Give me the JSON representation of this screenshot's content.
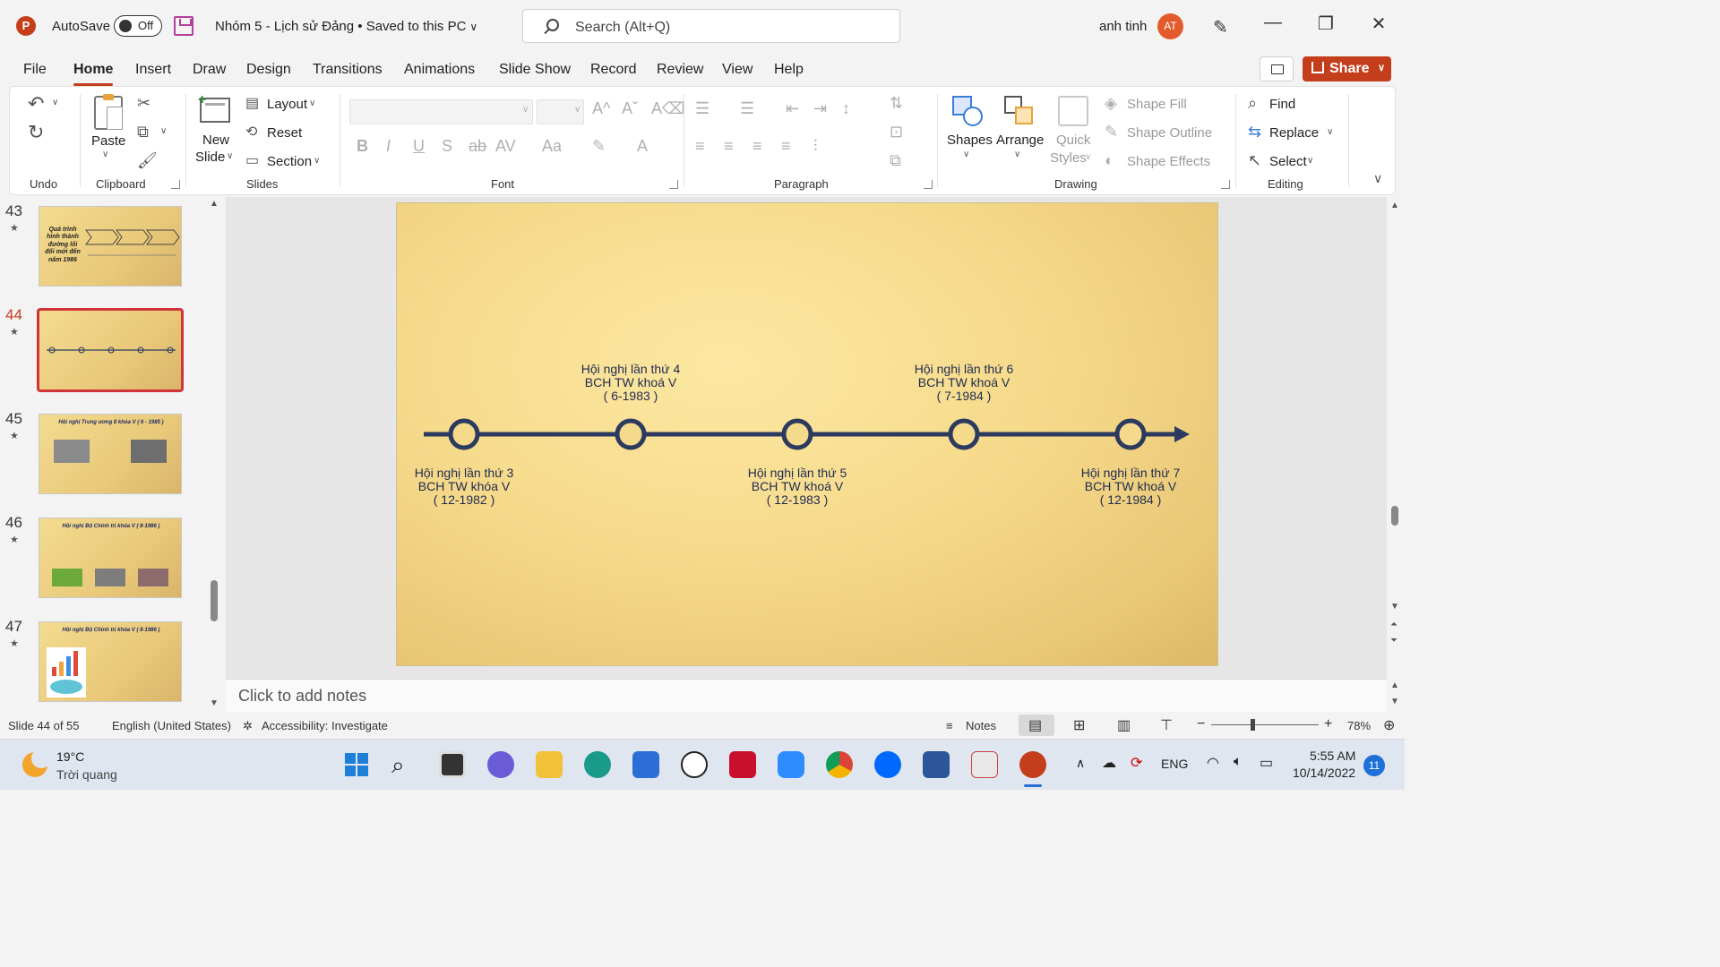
{
  "titlebar": {
    "autosave_label": "AutoSave",
    "autosave_state": "Off",
    "doc_title": "Nhóm 5 - Lịch sử Đảng • Saved to this PC",
    "search_placeholder": "Search (Alt+Q)",
    "user_name": "anh tinh",
    "user_initials": "AT"
  },
  "menu": {
    "tabs": [
      "File",
      "Home",
      "Insert",
      "Draw",
      "Design",
      "Transitions",
      "Animations",
      "Slide Show",
      "Record",
      "Review",
      "View",
      "Help"
    ],
    "active": "Home",
    "share_label": "Share"
  },
  "ribbon": {
    "groups": {
      "undo": "Undo",
      "clipboard": "Clipboard",
      "slides": "Slides",
      "font": "Font",
      "paragraph": "Paragraph",
      "drawing": "Drawing",
      "editing": "Editing"
    },
    "paste": "Paste",
    "new_slide_1": "New",
    "new_slide_2": "Slide",
    "layout": "Layout",
    "reset": "Reset",
    "section": "Section",
    "shapes": "Shapes",
    "arrange": "Arrange",
    "quick_styles_1": "Quick",
    "quick_styles_2": "Styles",
    "shape_fill": "Shape Fill",
    "shape_outline": "Shape Outline",
    "shape_effects": "Shape Effects",
    "find": "Find",
    "replace": "Replace",
    "select": "Select"
  },
  "thumbnails": [
    {
      "num": "43",
      "title": "Quá trình hình thành đường lối đổi mới đến năm 1986"
    },
    {
      "num": "44",
      "title": "",
      "selected": true
    },
    {
      "num": "45",
      "title": "Hội nghị Trung ương 8 khóa V ( 6 - 1985 )"
    },
    {
      "num": "46",
      "title": "Hội nghị Bộ Chính trị khóa V ( 8-1986 )"
    },
    {
      "num": "47",
      "title": "Hội nghị Bộ Chính trị khóa V ( 8-1986 )"
    }
  ],
  "slide": {
    "events_top": [
      {
        "l1": "Hội nghị lần thứ 4",
        "l2": "BCH TW khoá V",
        "l3": "( 6-1983 )"
      },
      {
        "l1": "Hội nghị lần thứ 6",
        "l2": "BCH TW khoá V",
        "l3": "( 7-1984 )"
      }
    ],
    "events_bottom": [
      {
        "l1": "Hội nghị lần thứ 3",
        "l2": "BCH TW khóa V",
        "l3": "( 12-1982 )"
      },
      {
        "l1": "Hội nghị lần thứ 5",
        "l2": "BCH TW khoá V",
        "l3": "( 12-1983 )"
      },
      {
        "l1": "Hội nghị lần thứ 7",
        "l2": "BCH TW khoá V",
        "l3": "( 12-1984 )"
      }
    ],
    "line_color": "#2b3a5e"
  },
  "notes_placeholder": "Click to add notes",
  "status": {
    "slide_count": "Slide 44 of 55",
    "language": "English (United States)",
    "accessibility": "Accessibility: Investigate",
    "notes": "Notes",
    "zoom": "78%"
  },
  "taskbar": {
    "temp": "19°C",
    "weather": "Trời quang",
    "lang": "ENG",
    "time": "5:55 AM",
    "date": "10/14/2022",
    "badge": "11"
  }
}
